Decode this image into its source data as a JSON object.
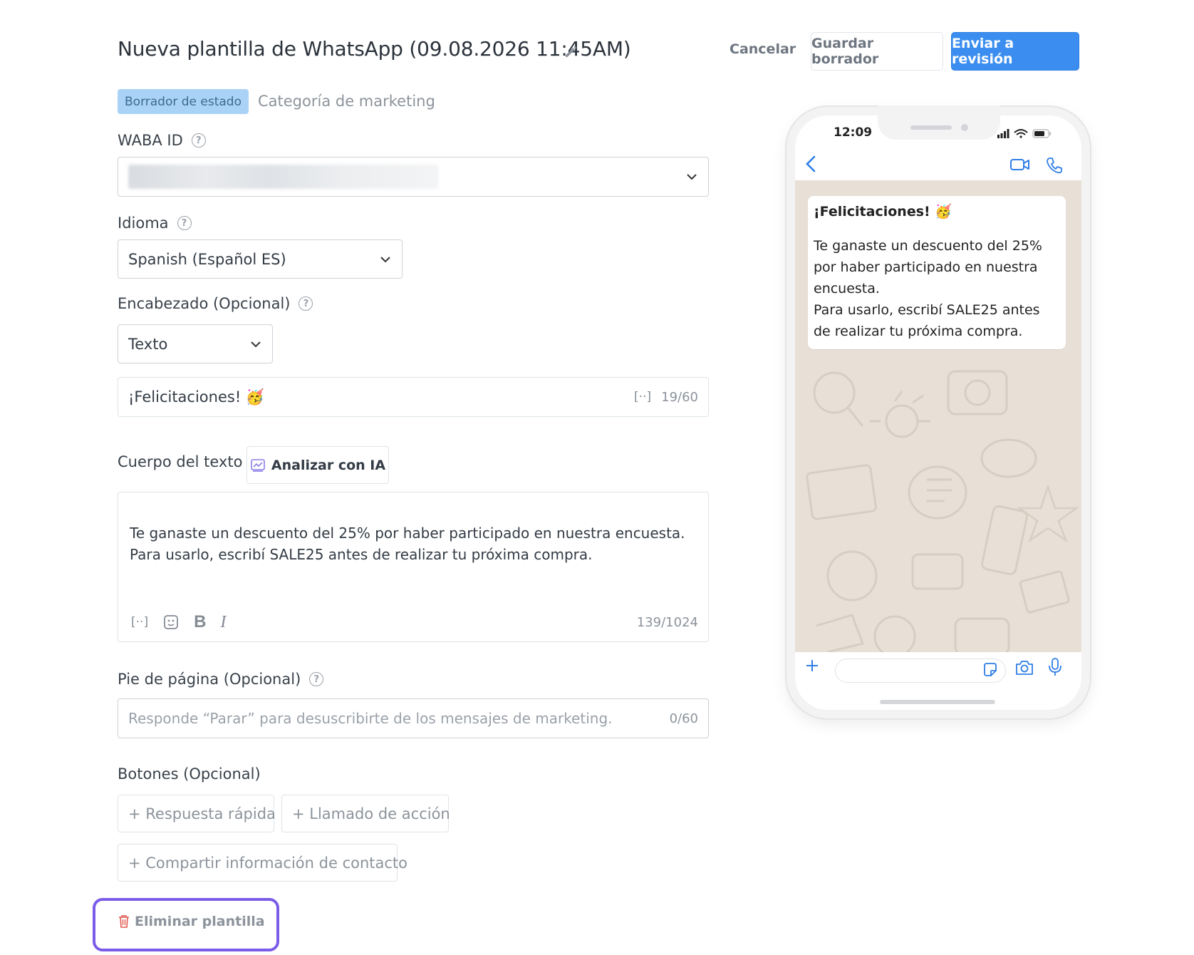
{
  "header": {
    "title": "Nueva plantilla de WhatsApp (09.08.2026 11:45AM)",
    "cancel_label": "Cancelar",
    "save_draft_label": "Guardar borrador",
    "submit_label": "Enviar a revisión"
  },
  "status": {
    "badge": "Borrador de estado",
    "category": "Categoría de marketing"
  },
  "waba": {
    "label": "WABA ID"
  },
  "language": {
    "label": "Idioma",
    "selected": "Spanish (Español ES)"
  },
  "header_section": {
    "label": "Encabezado (Opcional)",
    "type_selected": "Texto",
    "text_value": "¡Felicitaciones! 🥳",
    "counter": "19/60"
  },
  "body": {
    "label": "Cuerpo del texto",
    "ai_button": "Analizar con IA",
    "text": "Te ganaste un descuento del 25% por haber participado en nuestra encuesta.\nPara usarlo, escribí SALE25 antes de realizar tu próxima compra.",
    "counter": "139/1024"
  },
  "footer": {
    "label": "Pie de página (Opcional)",
    "placeholder": "Responde “Parar” para desuscribirte de los mensajes de marketing.",
    "counter": "0/60"
  },
  "buttons": {
    "label": "Botones (Opcional)",
    "quick_reply": "+ Respuesta rápida",
    "call_to_action": "+ Llamado de acción",
    "share_contact": "+ Compartir información de contacto"
  },
  "delete_label": "Eliminar plantilla",
  "phone_preview": {
    "time": "12:09",
    "message_header": "¡Felicitaciones! 🥳",
    "message_body": "Te ganaste un descuento del 25%\npor haber participado en nuestra\nencuesta.\nPara usarlo, escribí SALE25 antes\nde realizar tu próxima compra."
  },
  "colors": {
    "primary": "#3b8ef0",
    "badge_bg": "#a9d2f6",
    "highlight_outline": "#7b5ce8",
    "chat_bg": "#e8e0d6",
    "delete_icon": "#e0584f"
  },
  "icons": [
    "pencil-icon",
    "help-icon",
    "chevron-down-icon",
    "variable-icon",
    "ai-icon",
    "sticker-icon",
    "bold-icon",
    "italic-icon",
    "trash-icon",
    "back-icon",
    "video-icon",
    "phone-icon",
    "plus-icon",
    "camera-icon",
    "mic-icon",
    "signal-icon",
    "wifi-icon",
    "battery-icon"
  ]
}
